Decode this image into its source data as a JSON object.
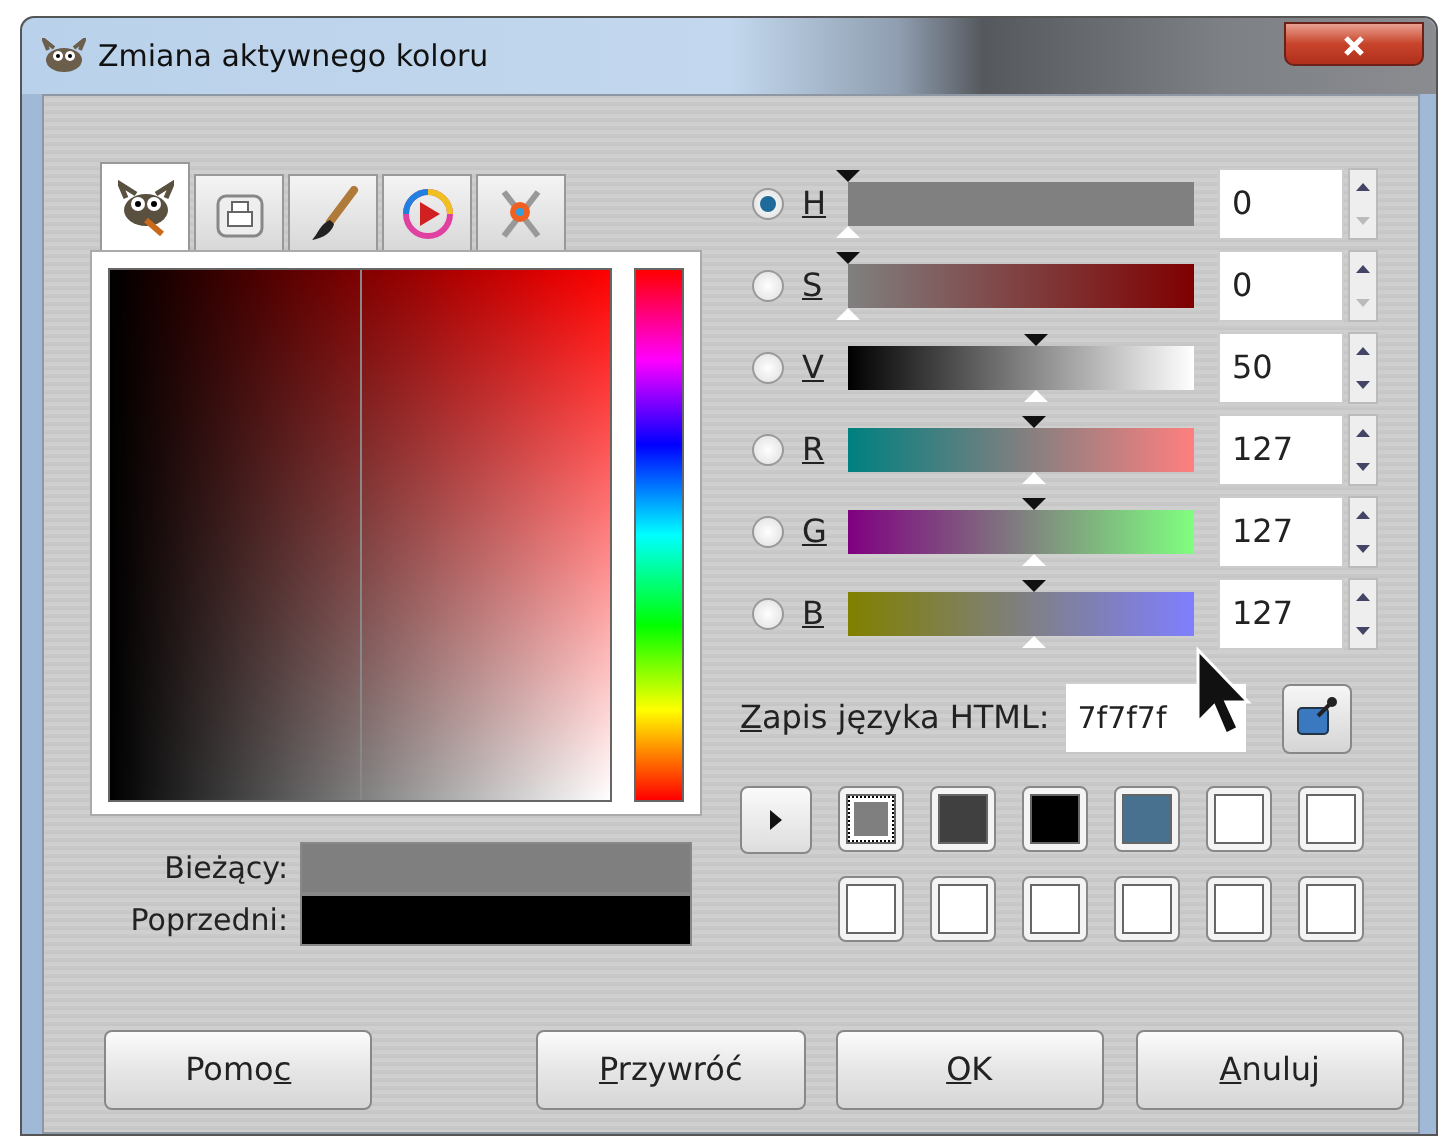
{
  "window": {
    "title": "Zmiana aktywnego koloru"
  },
  "tabs": [
    {
      "kind": "mascot",
      "selected": true
    },
    {
      "kind": "printer",
      "selected": false
    },
    {
      "kind": "brush",
      "selected": false
    },
    {
      "kind": "wheel",
      "selected": false
    },
    {
      "kind": "tools",
      "selected": false
    }
  ],
  "channels": [
    {
      "label": {
        "key": "H"
      },
      "kind": "hue",
      "selected": true,
      "level": 0,
      "value": "0",
      "down_disabled": true
    },
    {
      "label": {
        "key": "S"
      },
      "kind": "saturation",
      "selected": false,
      "level": 0,
      "value": "0",
      "down_disabled": true
    },
    {
      "label": {
        "key": "V"
      },
      "kind": "value",
      "selected": false,
      "level": 0.5,
      "value": "50",
      "down_disabled": false
    },
    {
      "label": {
        "key": "R"
      },
      "kind": "red",
      "selected": false,
      "level": 0.498,
      "value": "127",
      "down_disabled": false
    },
    {
      "label": {
        "key": "G"
      },
      "kind": "green",
      "selected": false,
      "level": 0.498,
      "value": "127",
      "down_disabled": false
    },
    {
      "label": {
        "key": "B"
      },
      "kind": "blue",
      "selected": false,
      "level": 0.498,
      "value": "127",
      "down_disabled": false
    }
  ],
  "html_notation": {
    "label": {
      "key": "Z",
      "post": "apis języka HTML:"
    },
    "value": "7f7f7f"
  },
  "history": [
    {
      "color": "#7f7f7f",
      "selected": true
    },
    {
      "color": "#404040",
      "selected": false
    },
    {
      "color": "#000000",
      "selected": false
    },
    {
      "color": "#48708f",
      "selected": false
    },
    {
      "color": "#ffffff",
      "selected": false
    },
    {
      "color": "#ffffff",
      "selected": false
    },
    {
      "color": "#ffffff",
      "selected": false
    },
    {
      "color": "#ffffff",
      "selected": false
    },
    {
      "color": "#ffffff",
      "selected": false
    },
    {
      "color": "#ffffff",
      "selected": false
    },
    {
      "color": "#ffffff",
      "selected": false
    },
    {
      "color": "#ffffff",
      "selected": false
    }
  ],
  "comparison": [
    {
      "label": "Bieżący:",
      "color": "#7f7f7f"
    },
    {
      "label": "Poprzedni:",
      "color": "#000000"
    }
  ],
  "buttons": [
    {
      "label": {
        "pre": "Pomo",
        "key": "c"
      }
    },
    {
      "label": {
        "key": "P",
        "post": "rzywróć"
      }
    },
    {
      "label": {
        "key": "O",
        "post": "K"
      }
    },
    {
      "label": {
        "key": "A",
        "post": "nuluj"
      }
    }
  ]
}
